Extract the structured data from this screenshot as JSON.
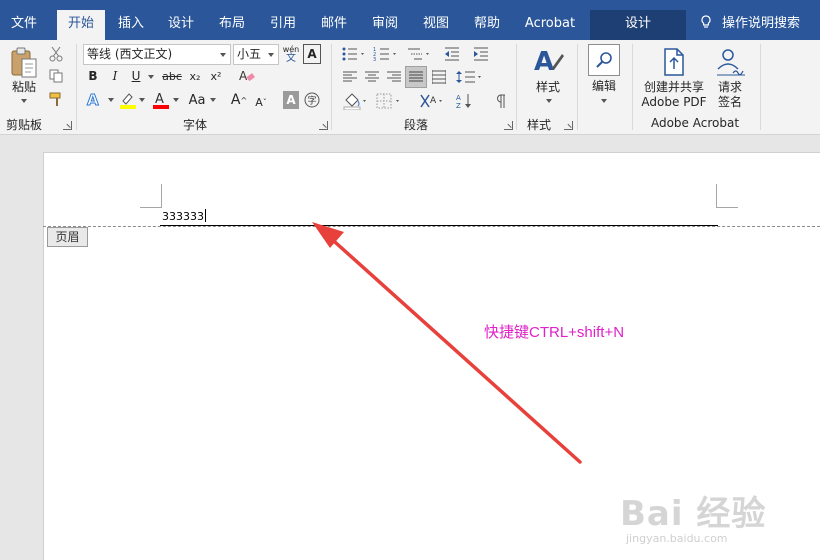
{
  "tabs": [
    {
      "label": "文件"
    },
    {
      "label": "开始"
    },
    {
      "label": "插入"
    },
    {
      "label": "设计"
    },
    {
      "label": "布局"
    },
    {
      "label": "引用"
    },
    {
      "label": "邮件"
    },
    {
      "label": "审阅"
    },
    {
      "label": "视图"
    },
    {
      "label": "帮助"
    },
    {
      "label": "Acrobat"
    },
    {
      "label": "设计"
    }
  ],
  "tell_me": "操作说明搜索",
  "ribbon": {
    "clipboard": {
      "paste_label": "粘贴",
      "group_label": "剪贴板"
    },
    "font": {
      "font_name": "等线 (西文正文)",
      "font_size": "小五",
      "bold": "B",
      "italic": "I",
      "underline": "U",
      "strike": "abc",
      "subscript": "x₂",
      "superscript": "x²",
      "change_case": "Aa",
      "grow": "A",
      "shrink": "A",
      "pinyin": "wén",
      "group_label": "字体"
    },
    "paragraph": {
      "group_label": "段落"
    },
    "styles": {
      "styles_label": "样式",
      "group_label": "样式"
    },
    "editing": {
      "edit_label": "编辑"
    },
    "acrobat": {
      "create_pdf_label_1": "创建并共享",
      "create_pdf_label_2": "Adobe PDF",
      "sign_label_1": "请求",
      "sign_label_2": "签名",
      "group_label": "Adobe Acrobat"
    }
  },
  "document": {
    "header_text": "333333",
    "header_tag": "页眉",
    "annotation": "快捷键CTRL+shift+N"
  },
  "watermark": {
    "brand": "Bai 经验",
    "url": "jingyan.baidu.com"
  },
  "colors": {
    "tab_bar": "#2b579a",
    "ribbon_bg": "#f3f3f3",
    "annotation_text": "#e020c8",
    "arrow": "#e8413c",
    "highlight_yellow": "#ffff00",
    "font_color_red": "#ff0000"
  }
}
